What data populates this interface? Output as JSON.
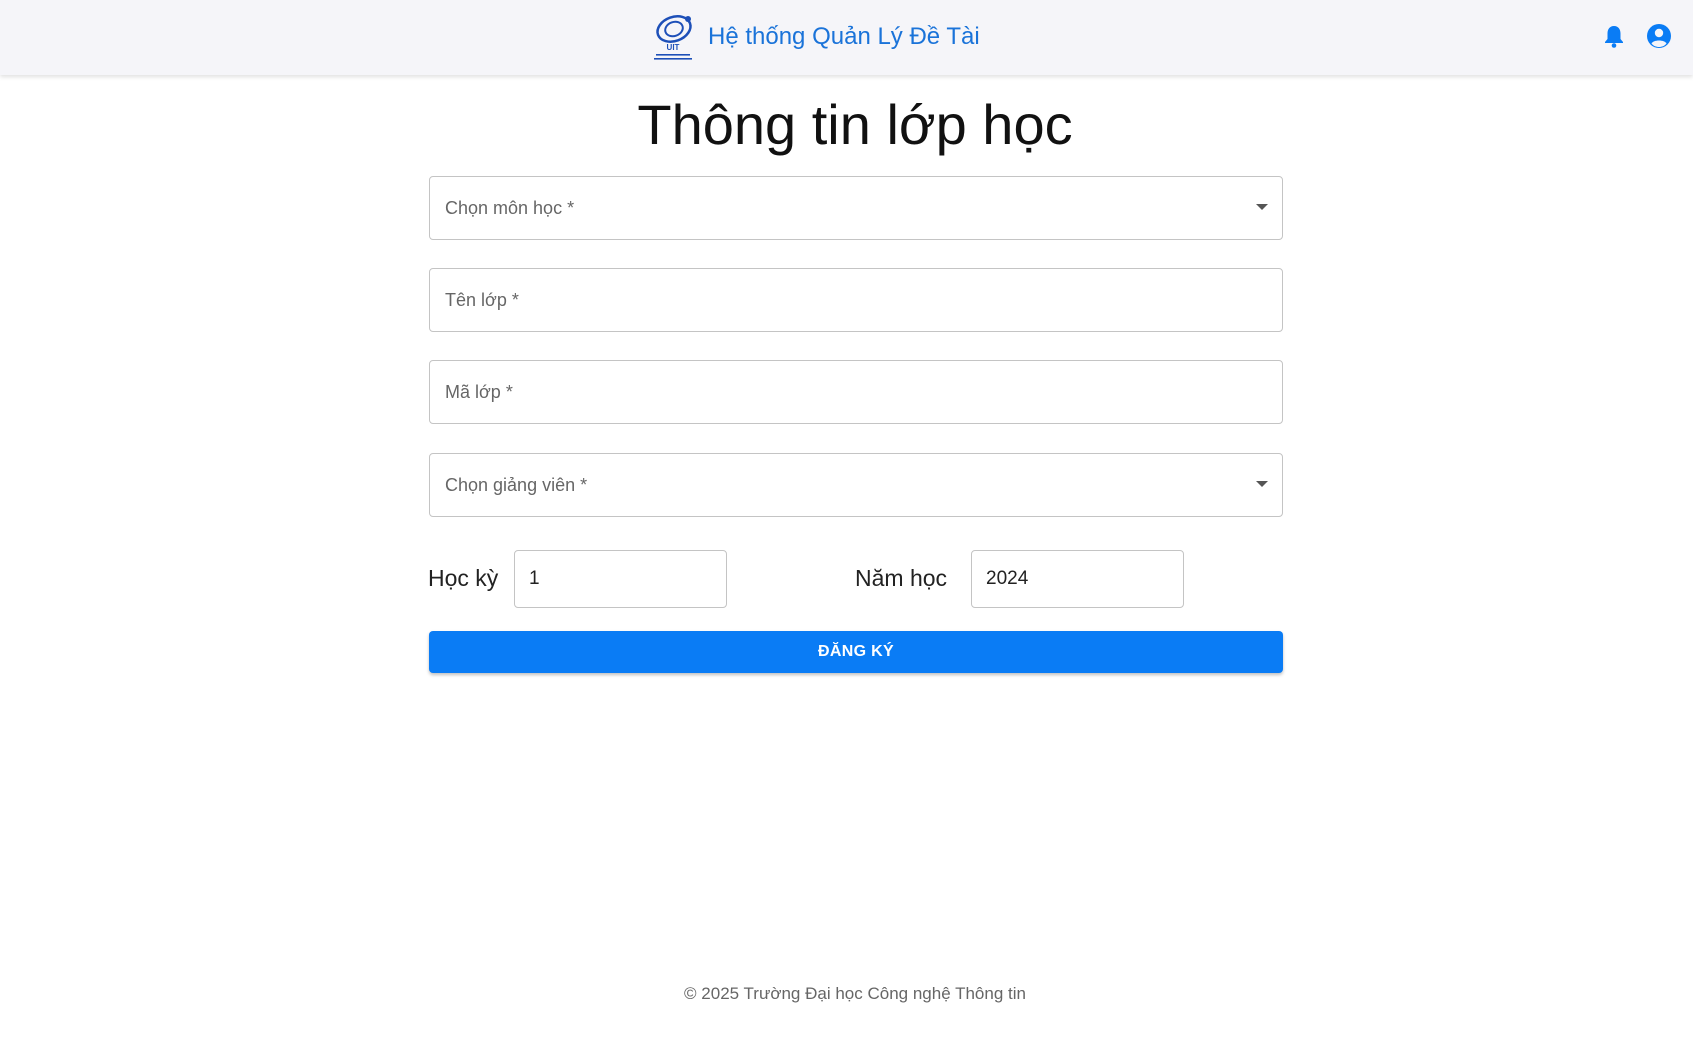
{
  "header": {
    "app_title": "Hệ thống Quản Lý Đề Tài",
    "logo_alt": "UIT",
    "brand_color": "#1a73d9",
    "icons": [
      "bell-icon",
      "account-circle-icon"
    ]
  },
  "page": {
    "title": "Thông tin lớp học"
  },
  "form": {
    "subject_select": {
      "label": "Chọn môn học *",
      "value": ""
    },
    "class_name": {
      "label": "Tên lớp *",
      "value": ""
    },
    "class_code": {
      "label": "Mã lớp *",
      "value": ""
    },
    "lecturer_select": {
      "label": "Chọn giảng viên *",
      "value": ""
    },
    "semester": {
      "label": "Học kỳ",
      "value": "1"
    },
    "school_year": {
      "label": "Năm học",
      "value": "2024"
    },
    "submit_label": "ĐĂNG KÝ",
    "accent_color": "#0a7cf5"
  },
  "footer": {
    "copyright": "© 2025 Trường Đại học Công nghệ Thông tin"
  }
}
